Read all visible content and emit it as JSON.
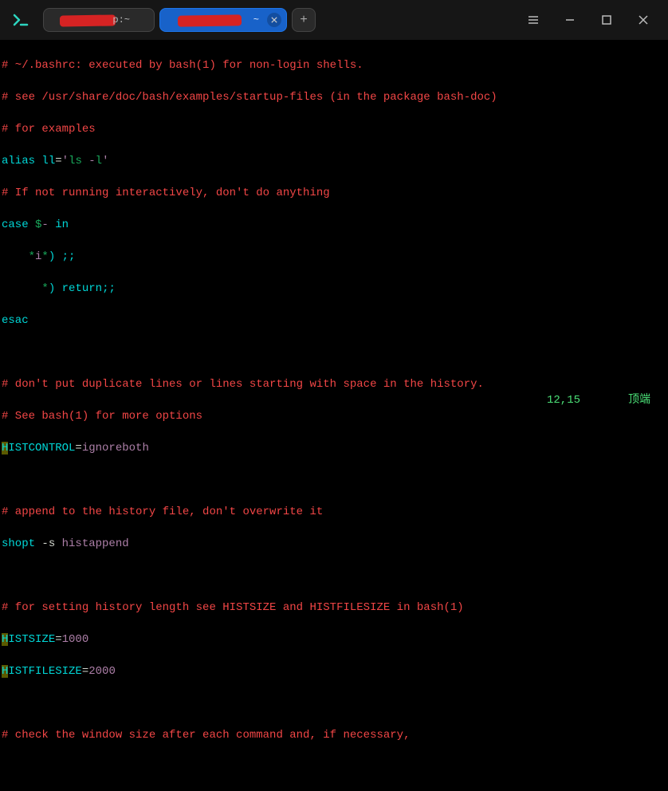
{
  "titlebar": {
    "tabs": [
      {
        "suffix": "p:~",
        "active": false
      },
      {
        "suffix": "~",
        "active": true
      }
    ],
    "new_tab_label": "+"
  },
  "code": {
    "l1": "# ~/.bashrc: executed by bash(1) for non-login shells.",
    "l2": "# see /usr/share/doc/bash/examples/startup-files (in the package bash-doc)",
    "l3": "# for examples",
    "l4_alias": "alias",
    "l4_ll": "ll",
    "l4_eq": "=",
    "l4_q1": "'",
    "l4_ls": "ls",
    "l4_sp": " -",
    "l4_l": "l",
    "l4_q2": "'",
    "l5": "# If not running interactively, don't do anything",
    "l6_case": "case",
    "l6_dollar": "$",
    "l6_dash": "-",
    "l6_in": "in",
    "l7_star1": "*",
    "l7_i": "i",
    "l7_star2": "*",
    "l7_paren": ")",
    "l7_semi": ";;",
    "l8_star": "*",
    "l8_paren": ")",
    "l8_return": "return",
    "l8_semi": ";;",
    "l9_esac": "esac",
    "l11": "# don't put duplicate lines or lines starting with space in the history.",
    "l12": "# See bash(1) for more options",
    "l13_h": "H",
    "l13_var": "ISTCONTROL",
    "l13_eq": "=",
    "l13_val": "ignoreboth",
    "l15": "# append to the history file, don't overwrite it",
    "l16_shopt": "shopt",
    "l16_s": " -s ",
    "l16_histappend": "histappend",
    "l18": "# for setting history length see HISTSIZE and HISTFILESIZE in bash(1)",
    "l19_h": "H",
    "l19_var": "ISTSIZE",
    "l19_eq": "=",
    "l19_val": "1000",
    "l20_h": "H",
    "l20_var": "ISTFILESIZE",
    "l20_eq": "=",
    "l20_val": "2000",
    "l22": "# check the window size after each command and, if necessary,"
  },
  "status": {
    "position": "12,15",
    "right": "顶端"
  }
}
